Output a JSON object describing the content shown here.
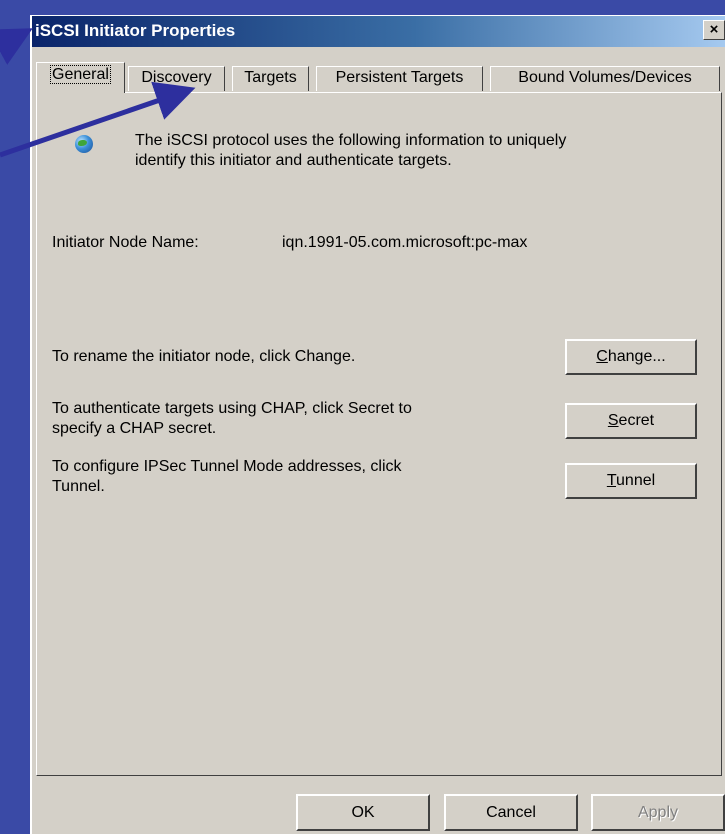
{
  "window": {
    "title": "iSCSI Initiator Properties",
    "close_label": "×"
  },
  "tabs": [
    {
      "label": "General",
      "active": true
    },
    {
      "label": "Discovery",
      "active": false
    },
    {
      "label": "Targets",
      "active": false
    },
    {
      "label": "Persistent Targets",
      "active": false
    },
    {
      "label": "Bound Volumes/Devices",
      "active": false
    }
  ],
  "general": {
    "intro_line1": "The iSCSI protocol uses the following information to uniquely",
    "intro_line2": "identify this initiator and authenticate targets.",
    "node_name_label": "Initiator Node Name:",
    "node_name_value": "iqn.1991-05.com.microsoft:pc-max",
    "rename_text": "To rename the initiator node, click Change.",
    "chap_text_line1": "To authenticate targets using CHAP, click Secret to",
    "chap_text_line2": "specify a CHAP secret.",
    "ipsec_text_line1": "To configure IPSec Tunnel Mode addresses, click",
    "ipsec_text_line2": "Tunnel.",
    "change_button": {
      "accel": "C",
      "rest": "hange..."
    },
    "secret_button": {
      "accel": "S",
      "rest": "ecret"
    },
    "tunnel_button": {
      "accel": "T",
      "rest": "unnel"
    }
  },
  "footer": {
    "ok": "OK",
    "cancel": "Cancel",
    "apply": "Apply"
  },
  "colors": {
    "background": "#3a4aa6",
    "dialog_face": "#d4d0c8",
    "title_gradient_start": "#0a246a",
    "arrow": "#2d2f9e"
  }
}
